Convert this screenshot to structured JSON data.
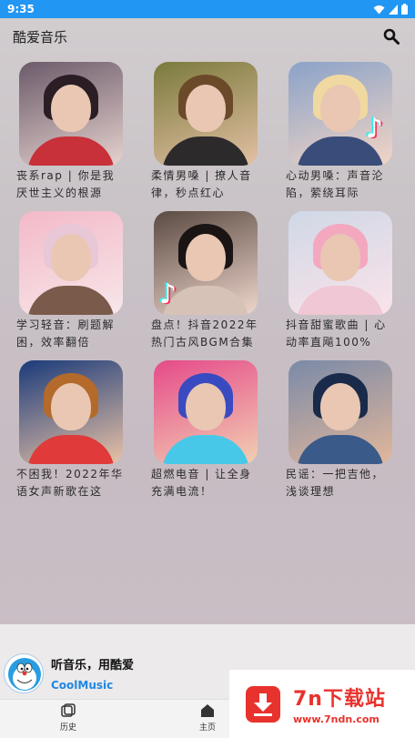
{
  "status_bar": {
    "time": "9:35"
  },
  "app_bar": {
    "title": "酷爱音乐",
    "search_icon": "search-icon"
  },
  "playlists": [
    {
      "title": "丧系rap | 你是我厌世主义的根源",
      "palette": [
        "#6b5a6a",
        "#2a1e24",
        "#c8303a",
        "#e6d2ce"
      ],
      "badge": false
    },
    {
      "title": "柔情男嗓 | 撩人音律，秒点红心",
      "palette": [
        "#7a7a3c",
        "#6b4a2a",
        "#2d2a2c",
        "#e3c0a4"
      ],
      "badge": false
    },
    {
      "title": "心动男嗓：声音沦陷，萦绕耳际",
      "palette": [
        "#8aa2c8",
        "#f0d9a0",
        "#3a4d7a",
        "#f2d5c5"
      ],
      "badge": true
    },
    {
      "title": "学习轻音：刷题解困，效率翻倍",
      "palette": [
        "#f3b9c8",
        "#e8c7d7",
        "#7a5a4a",
        "#f7e7ea"
      ],
      "badge": false
    },
    {
      "title": "盘点！抖音2022年热门古风BGM合集",
      "palette": [
        "#5a4a42",
        "#1a1414",
        "#d7c2b8",
        "#efd6cc"
      ],
      "badge": true
    },
    {
      "title": "抖音甜蜜歌曲 | 心动率直飚100%",
      "palette": [
        "#cfd8e6",
        "#f3a8c0",
        "#f0c7d4",
        "#fbe3ea"
      ],
      "badge": false
    },
    {
      "title": "不困我！2022年华语女声新歌在这",
      "palette": [
        "#1a3a7a",
        "#b36a2a",
        "#e03a3a",
        "#eac3a6"
      ],
      "badge": false
    },
    {
      "title": "超燃电音 | 让全身充满电流！",
      "palette": [
        "#e64a8a",
        "#3a4ac0",
        "#48c8e8",
        "#f2d0b2"
      ],
      "badge": false
    },
    {
      "title": "民谣：一把吉他，浅谈理想",
      "palette": [
        "#7a8aa8",
        "#1a2a4a",
        "#3a5a8a",
        "#e2b79a"
      ],
      "badge": false
    }
  ],
  "player": {
    "title": "听音乐，用酷爱",
    "subtitle": "CoolMusic"
  },
  "bottom_nav": [
    {
      "label": "历史",
      "icon": "history-icon"
    },
    {
      "label": "主页",
      "icon": "home-icon"
    }
  ],
  "watermark": {
    "name": "7n下载站",
    "url": "www.7ndn.com"
  }
}
